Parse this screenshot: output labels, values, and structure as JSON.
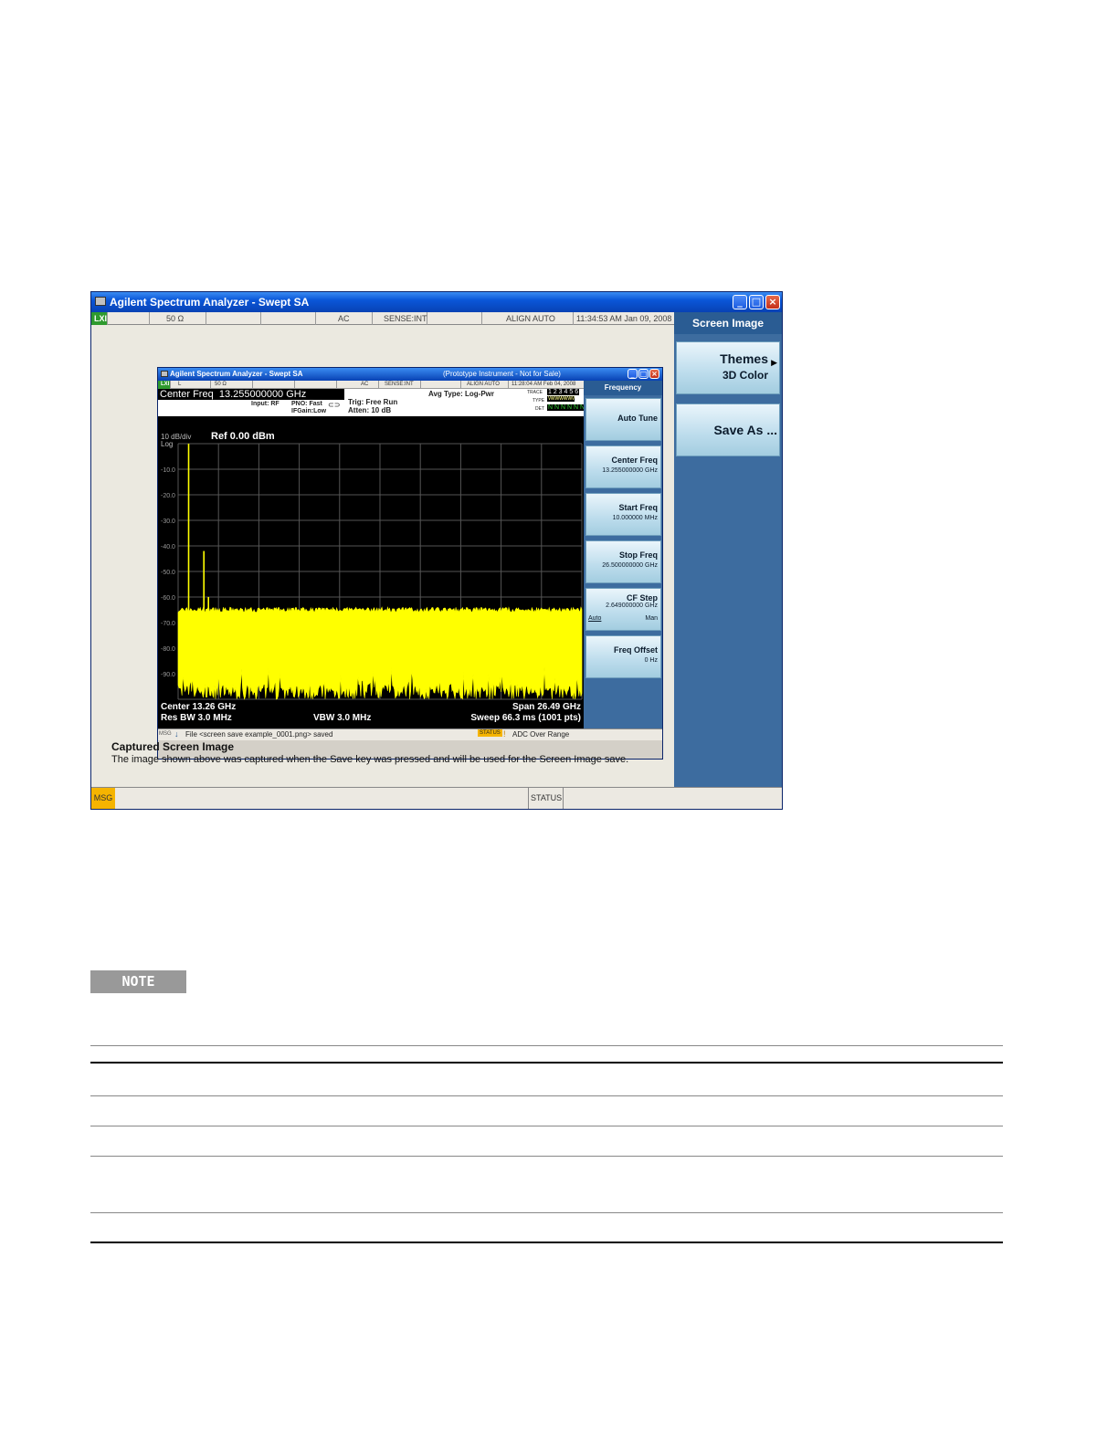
{
  "outer_window": {
    "title": "Agilent Spectrum Analyzer - Swept SA",
    "status_cells": [
      "LXI",
      "50 Ω",
      "AC",
      "SENSE:INT",
      "ALIGN AUTO",
      "11:34:53 AM Jan 09, 2008"
    ],
    "softkeys": {
      "title": "Screen Image",
      "themes_label": "Themes",
      "themes_value": "3D Color",
      "save_as_label": "Save As ..."
    },
    "caption_title": "Captured Screen Image",
    "caption_text": "The image shown above was captured when the Save key was pressed and will be used for the Screen Image save.",
    "bottom_msg": "MSG",
    "bottom_status": "STATUS"
  },
  "inner_window": {
    "title": "Agilent Spectrum Analyzer - Swept SA",
    "subtitle": "(Prototype Instrument - Not for Sale)",
    "status_cells": [
      "LXI",
      "L",
      "50 Ω",
      "AC",
      "SENSE:INT",
      "ALIGN AUTO",
      "11:28:04 AM Feb 04, 2008"
    ],
    "center_freq_label": "Center Freq",
    "center_freq_value": "13.255000000 GHz",
    "input": "Input: RF",
    "pno": "PNO: Fast",
    "ifgain": "IFGain:Low",
    "trig": "Trig: Free Run",
    "atten": "Atten: 10 dB",
    "avg_type": "Avg Type: Log-Pwr",
    "trace_label": "TRACE",
    "trace_numbers": "1 2 3 4 5 6",
    "type_label": "TYPE",
    "type_value": "WWWWWW",
    "det_label": "DET",
    "det_value": "N N N N N N",
    "softkeys": {
      "title": "Frequency",
      "auto_tune": "Auto Tune",
      "center_freq_label": "Center Freq",
      "center_freq_value": "13.255000000 GHz",
      "start_freq_label": "Start Freq",
      "start_freq_value": "10.000000 MHz",
      "stop_freq_label": "Stop Freq",
      "stop_freq_value": "26.500000000 GHz",
      "cf_step_label": "CF Step",
      "cf_step_value": "2.649000000 GHz",
      "cf_step_auto": "Auto",
      "cf_step_man": "Man",
      "freq_offset_label": "Freq Offset",
      "freq_offset_value": "0 Hz"
    },
    "msg_label": "MSG",
    "msg_text": "File <screen save example_0001.png> saved",
    "status_label": "STATUS",
    "status_text": "ADC Over Range"
  },
  "chart_data": {
    "type": "line",
    "scale_label": "10 dB/div",
    "scale_type": "Log",
    "ref_level": "Ref 0.00 dBm",
    "y_ticks": [
      "-10.0",
      "-20.0",
      "-30.0",
      "-40.0",
      "-50.0",
      "-60.0",
      "-70.0",
      "-80.0",
      "-90.0"
    ],
    "ylim": [
      -100,
      0
    ],
    "xlim": [
      0.01,
      26.5
    ],
    "grid": true,
    "trace_color": "#ffff00",
    "noise_floor_top_dbm": [
      -66,
      -64
    ],
    "noise_floor_bottom_dbm": [
      -100,
      -94
    ],
    "spurs": [
      {
        "x_ghz": 0.7,
        "level_dbm": 0
      },
      {
        "x_ghz": 1.7,
        "level_dbm": -42
      },
      {
        "x_ghz": 2.0,
        "level_dbm": -60
      }
    ],
    "footer": {
      "center": "Center 13.26 GHz",
      "span": "Span 26.49 GHz",
      "res_bw": "Res BW 3.0 MHz",
      "vbw": "VBW 3.0 MHz",
      "sweep": "Sweep  66.3 ms (1001 pts)"
    }
  },
  "note_label": "NOTE"
}
